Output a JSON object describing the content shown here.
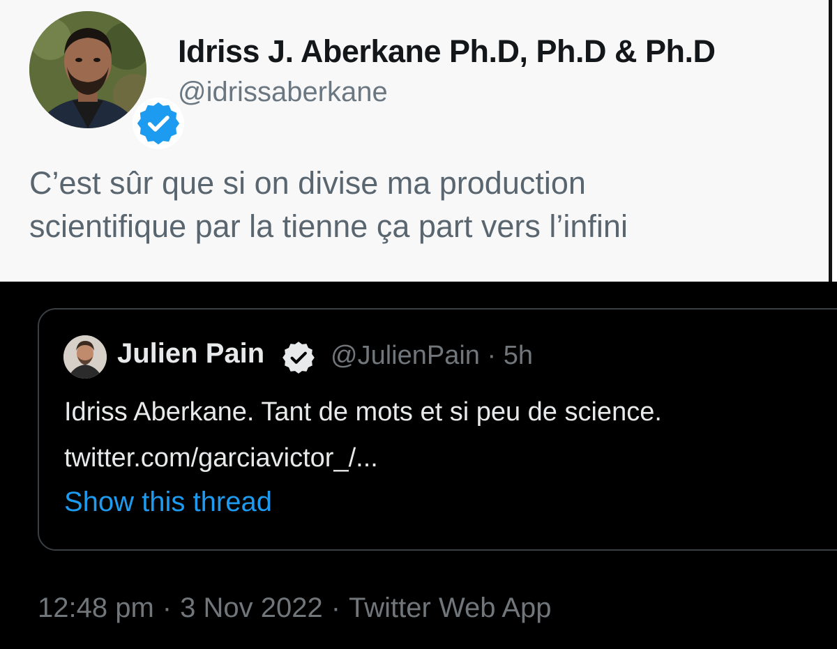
{
  "main_tweet": {
    "author_name": "Idriss J. Aberkane Ph.D, Ph.D & Ph.D",
    "author_handle": "@idrissaberkane",
    "text_lines": [
      "C’est sûr que si on divise ma production",
      "scientifique par la tienne ça part vers l’infini"
    ]
  },
  "quoted_tweet": {
    "author_name": "Julien Pain",
    "author_handle": "@JulienPain",
    "separator": "·",
    "time_ago": "5h",
    "text_lines": [
      "Idriss Aberkane. Tant de mots et si peu de science.",
      "twitter.com/garciavictor_/..."
    ],
    "show_thread_label": "Show this thread"
  },
  "meta": {
    "time": "12:48 pm",
    "date": "3 Nov 2022",
    "source": "Twitter Web App",
    "separator": "·"
  },
  "icons": {
    "verified_badge": "verified-badge-icon",
    "avatar_large": "avatar",
    "avatar_small": "avatar"
  },
  "colors": {
    "verified_blue": "#1d9bf0",
    "link_blue": "#1d9bf0",
    "light_bg": "#f8f8f9",
    "dark_bg": "#000000",
    "dark_border": "#3a3f44"
  }
}
